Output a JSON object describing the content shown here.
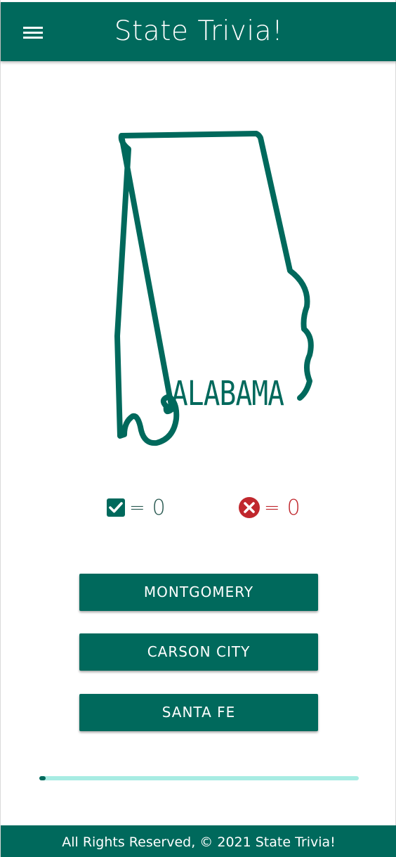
{
  "header": {
    "title": "State Trivia!",
    "menu_icon": "menu-icon"
  },
  "question": {
    "state_name": "ALABAMA",
    "map_icon": "alabama-outline-icon"
  },
  "score": {
    "correct": {
      "icon": "check-box-icon",
      "eq": "=",
      "value": "0"
    },
    "wrong": {
      "icon": "cancel-circle-icon",
      "eq": "=",
      "value": "0"
    }
  },
  "answers": [
    {
      "label": "MONTGOMERY"
    },
    {
      "label": "CARSON CITY"
    },
    {
      "label": "SANTA FE"
    }
  ],
  "progress": {
    "fraction": 0.02
  },
  "footer": {
    "text": "All Rights Reserved, © 2021 State Trivia!"
  },
  "colors": {
    "primary": "#00695c",
    "progress_track": "#a7ece3",
    "wrong": "#c0272d",
    "background": "#ffffff"
  }
}
